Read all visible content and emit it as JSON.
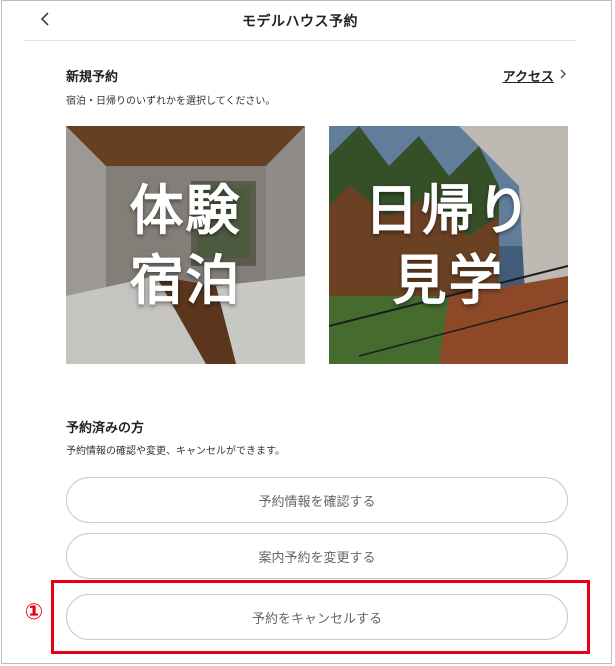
{
  "header": {
    "title": "モデルハウス予約"
  },
  "new_reservation": {
    "title": "新規予約",
    "description": "宿泊・日帰りのいずれかを選択してください。",
    "access_label": "アクセス",
    "cards": [
      {
        "line1": "体験",
        "line2": "宿泊"
      },
      {
        "line1": "日帰り",
        "line2": "見学"
      }
    ]
  },
  "existing": {
    "title": "予約済みの方",
    "description": "予約情報の確認や変更、キャンセルができます。",
    "buttons": {
      "confirm": "予約情報を確認する",
      "change": "案内予約を変更する",
      "cancel": "予約をキャンセルする"
    }
  },
  "annotation": {
    "marker": "①",
    "color": "#e60012"
  }
}
